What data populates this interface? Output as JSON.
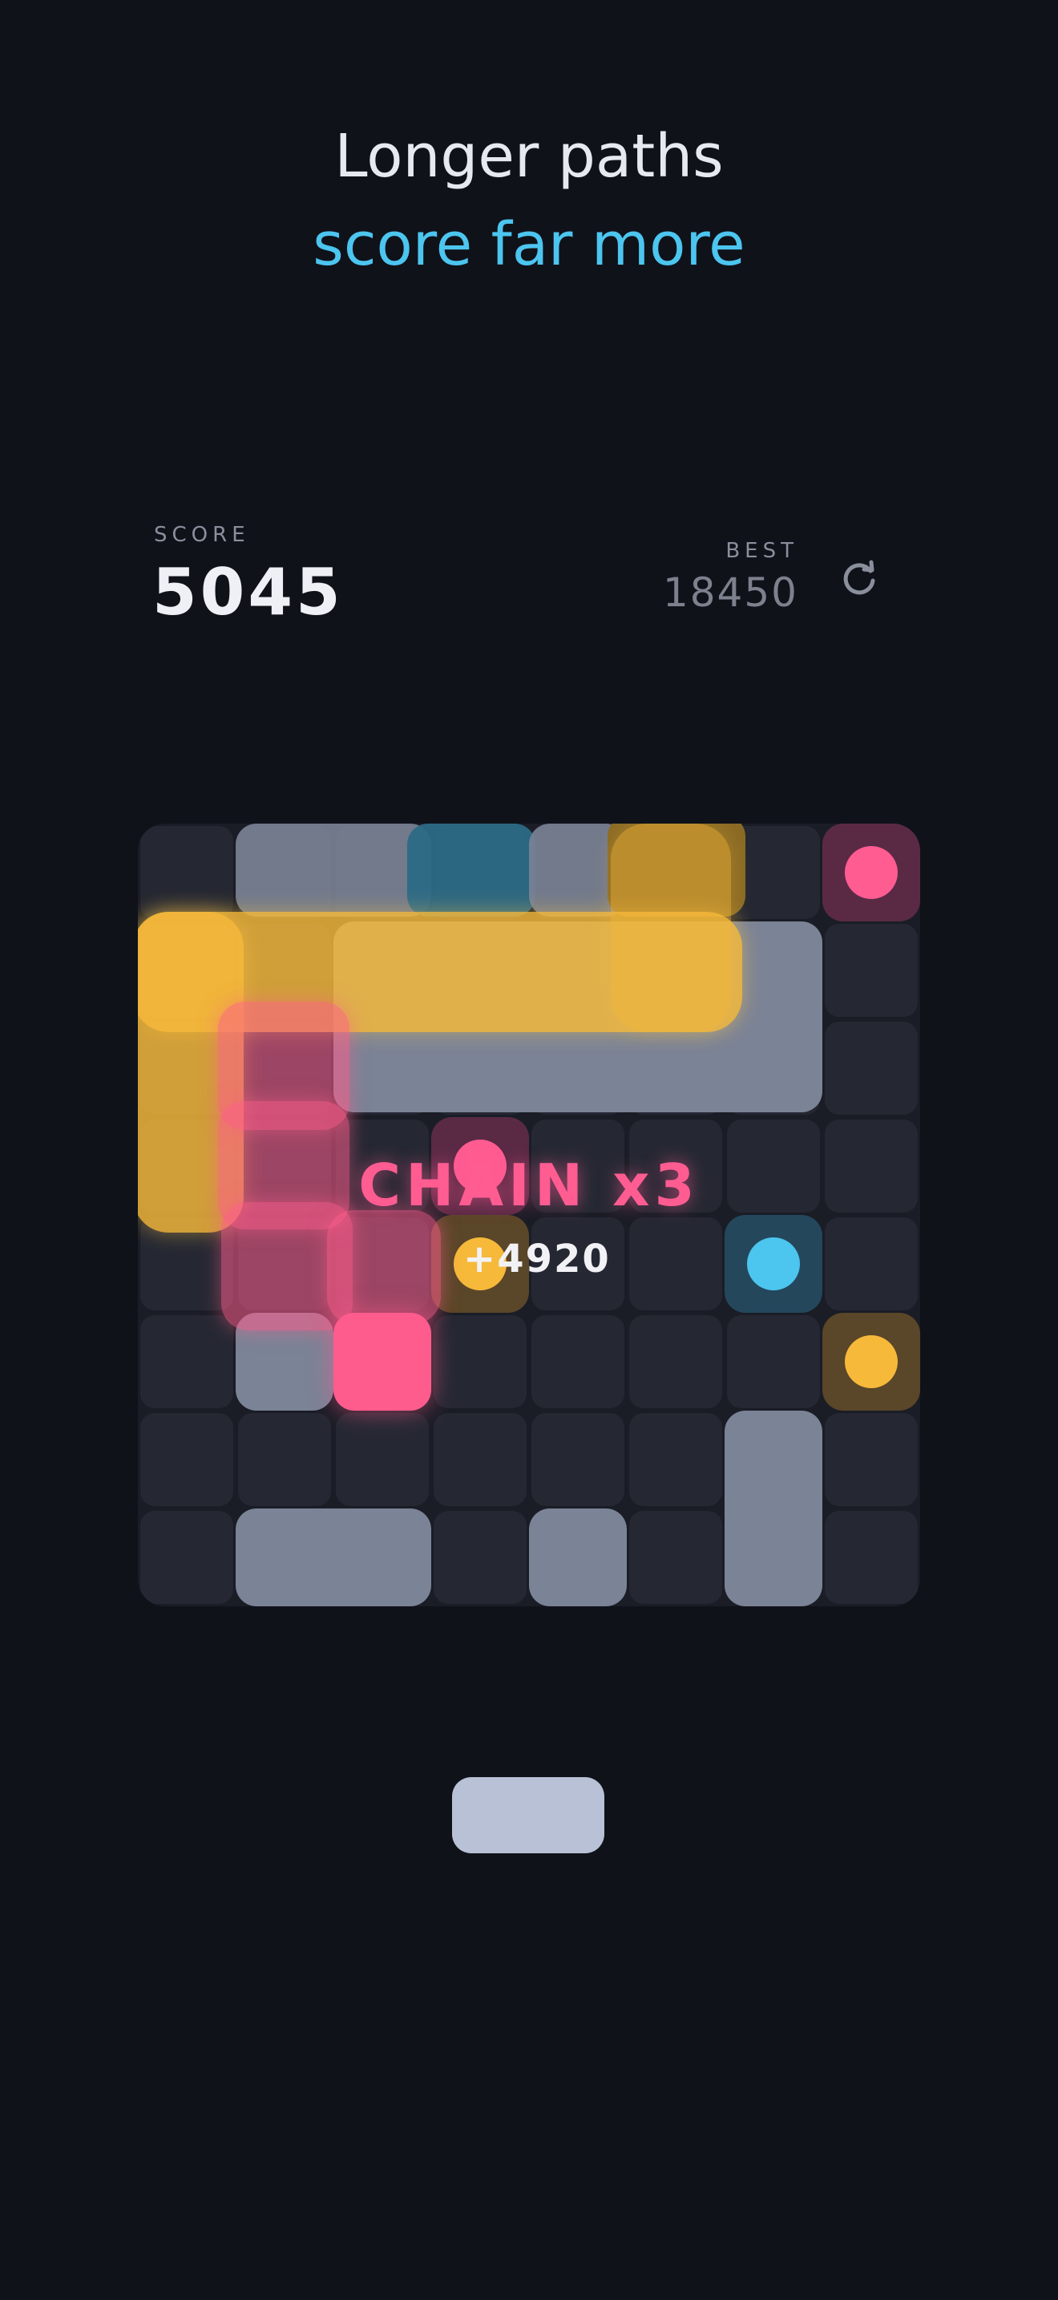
{
  "header": {
    "line1": "Longer paths",
    "line2": "score far more"
  },
  "stats": {
    "score_label": "SCORE",
    "score_value": "5045",
    "best_label": "BEST",
    "best_value": "18450"
  },
  "icons": {
    "restart": "restart-icon"
  },
  "board": {
    "rows": 8,
    "cols": 8
  },
  "chain": {
    "label": "CHAIN x3",
    "points": "+4920"
  },
  "colors": {
    "background": "#10121a",
    "accent_blue": "#4cc5ef",
    "pink": "#ff5c92",
    "yellow": "#f6b93a",
    "grey_block": "#7b8396",
    "button": "#b9c1d6"
  }
}
